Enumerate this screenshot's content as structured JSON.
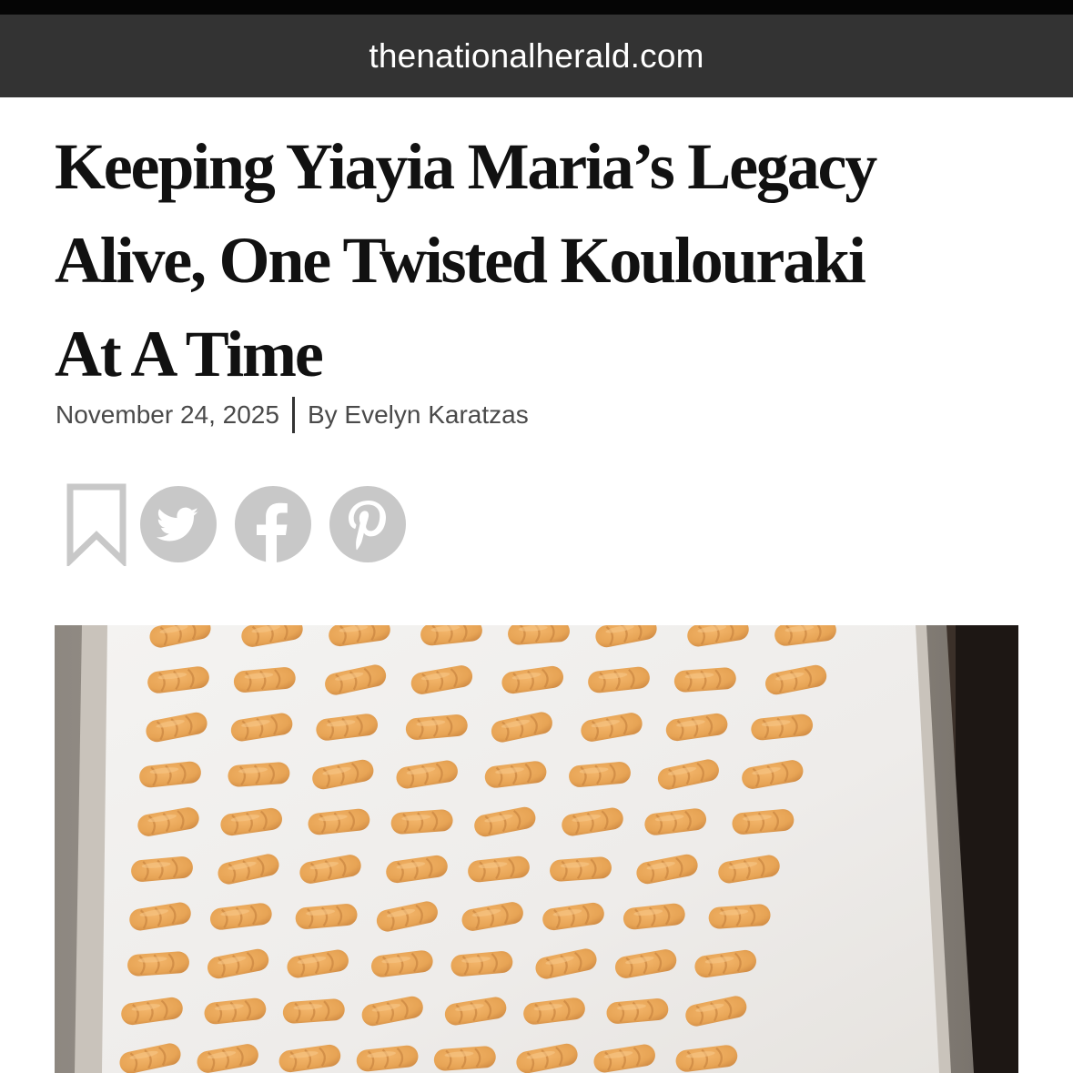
{
  "browser": {
    "url": "thenationalherald.com"
  },
  "article": {
    "title": "Keeping Yiayia Maria’s Legacy Alive, One Twisted Koulouraki At A Time",
    "title_lines": [
      "Keeping Yiayia Maria’s Legacy",
      "Alive, One Twisted Koulouraki",
      "At A Time"
    ],
    "date": "November 24, 2025",
    "author": "By Evelyn Karatzas"
  },
  "share": {
    "icons": [
      "bookmark-icon",
      "twitter-icon",
      "facebook-icon",
      "pinterest-icon"
    ],
    "icon_color": "#c8c8c8"
  },
  "colors": {
    "url_bar": "#333333",
    "headline": "#111111",
    "meta_text": "#4a4a4a",
    "cookie": "#e9a85a",
    "parchment": "#f1efed"
  }
}
